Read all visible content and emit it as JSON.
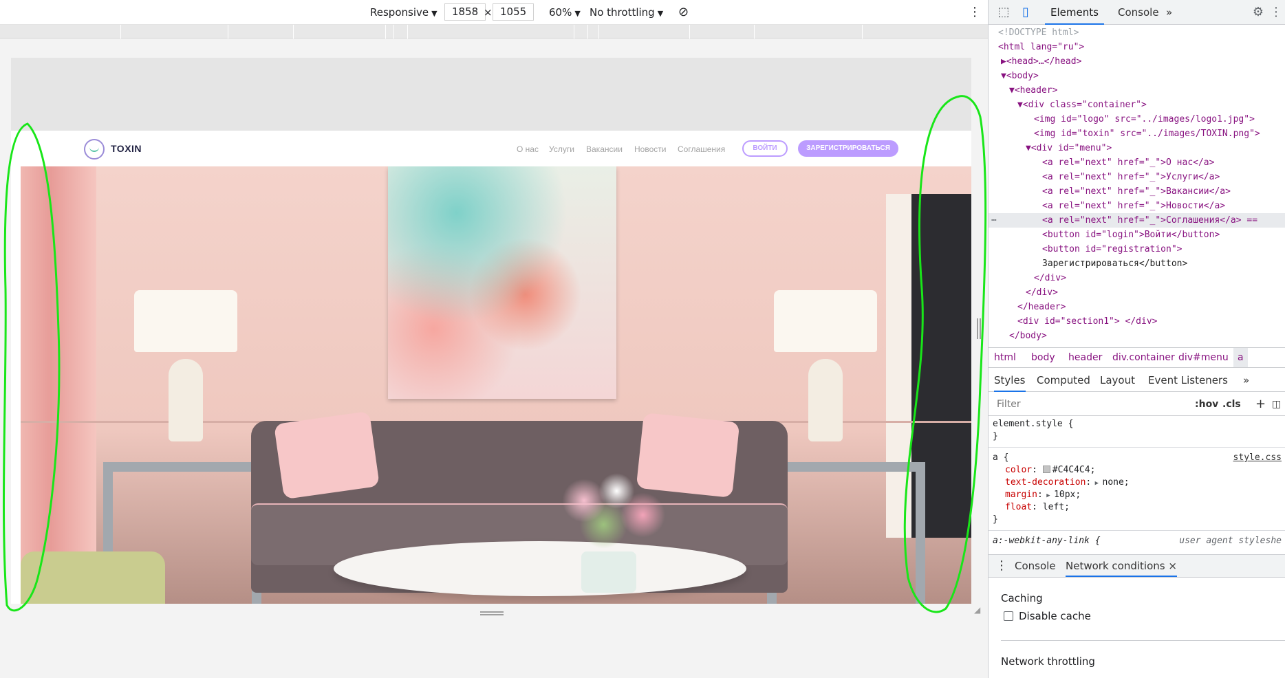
{
  "device_toolbar": {
    "mode": "Responsive",
    "width": "1858",
    "times": "×",
    "height": "1055",
    "zoom": "60%",
    "throttling": "No throttling"
  },
  "website": {
    "logo_text": "TOXIN",
    "nav": [
      "О нас",
      "Услуги",
      "Вакансии",
      "Новости",
      "Соглашения"
    ],
    "login_label": "ВОЙТИ",
    "register_label": "ЗАРЕГИСТРИРОВАТЬСЯ",
    "accent_color": "#BC9CFF"
  },
  "devtools": {
    "tabs": [
      "Elements",
      "Console"
    ],
    "more": "»",
    "dom": [
      {
        "t": "cmt",
        "text": "<!DOCTYPE html>"
      },
      {
        "t": "line",
        "text": "<html lang=\"ru\">"
      },
      {
        "t": "line",
        "text": "▶<head>…</head>"
      },
      {
        "t": "line",
        "text": "▼<body>"
      },
      {
        "t": "line",
        "text": "▼<header>"
      },
      {
        "t": "line",
        "text": "▼<div class=\"container\">"
      },
      {
        "t": "line",
        "text": "<img id=\"logo\" src=\"../images/logo1.jpg\">"
      },
      {
        "t": "line",
        "text": "<img id=\"toxin\" src=\"../images/TOXIN.png\">"
      },
      {
        "t": "line",
        "text": "▼<div id=\"menu\">"
      },
      {
        "t": "line",
        "text": "<a rel=\"next\" href=\"_\">О нас</a>"
      },
      {
        "t": "line",
        "text": "<a rel=\"next\" href=\"_\">Услуги</a>"
      },
      {
        "t": "line",
        "text": "<a rel=\"next\" href=\"_\">Вакансии</a>"
      },
      {
        "t": "line",
        "text": "<a rel=\"next\" href=\"_\">Новости</a>"
      },
      {
        "t": "line",
        "text": "<a rel=\"next\" href=\"_\">Соглашения</a> =="
      },
      {
        "t": "line",
        "text": "<button id=\"login\">Войти</button>"
      },
      {
        "t": "line",
        "text": "<button id=\"registration\">"
      },
      {
        "t": "line",
        "text": "Зарегистрироваться</button>"
      },
      {
        "t": "line",
        "text": "</div>"
      },
      {
        "t": "line",
        "text": "</div>"
      },
      {
        "t": "line",
        "text": "</header>"
      },
      {
        "t": "line",
        "text": "<div id=\"section1\"> </div>"
      },
      {
        "t": "line",
        "text": "</body>"
      }
    ],
    "breadcrumbs": [
      "html",
      "body",
      "header",
      "div.container",
      "div#menu",
      "a"
    ],
    "sub_tabs": [
      "Styles",
      "Computed",
      "Layout",
      "Event Listeners"
    ],
    "filter_placeholder": "Filter",
    "hov": ":hov",
    "cls": ".cls",
    "plus": "+",
    "styles": {
      "element_style": "element.style {",
      "close": "}",
      "a_selector": "a {",
      "a_source": "style.css",
      "props": [
        {
          "name": "color",
          "value": "#C4C4C4;"
        },
        {
          "name": "text-decoration",
          "value": "none;"
        },
        {
          "name": "margin",
          "value": "10px;"
        },
        {
          "name": "float",
          "value": "left;"
        }
      ],
      "ua_selector": "a:-webkit-any-link {",
      "ua_source": "user agent styleshe"
    },
    "drawer_tabs": [
      "Console",
      "Network conditions"
    ],
    "drawer_close": "×",
    "network_conditions": {
      "caching": "Caching",
      "disable_cache": "Disable cache",
      "throttling": "Network throttling"
    }
  }
}
